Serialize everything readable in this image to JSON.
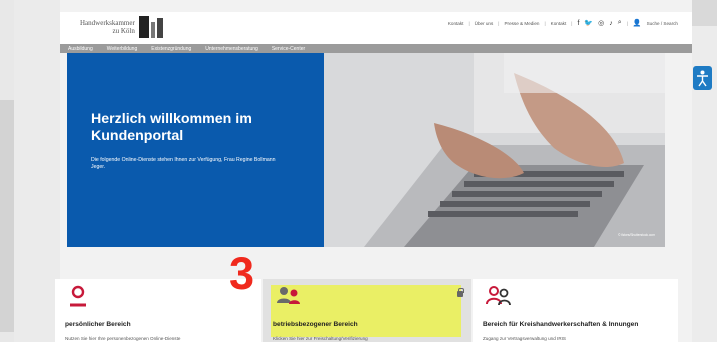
{
  "colors": {
    "hero_blue": "#0a5aad",
    "accent_red": "#c7193a",
    "highlight": "#eaf05a",
    "badge_red": "#f0291d",
    "nav_grey": "#9b9b9b"
  },
  "logo": {
    "line1": "Handwerkskammer",
    "line2": "zu Köln"
  },
  "topnav": {
    "items": [
      "Kontakt",
      "Über uns",
      "Presse & Medien",
      "Kontakt"
    ],
    "search": "Suche / Search",
    "icons": [
      "facebook-icon",
      "twitter-icon",
      "instagram-icon",
      "tiktok-icon",
      "search-icon",
      "user-icon"
    ]
  },
  "mainnav": {
    "items": [
      "Ausbildung",
      "Weiterbildung",
      "Existenzgründung",
      "Unternehmensberatung",
      "Service-Center"
    ]
  },
  "hero": {
    "title": "Herzlich willkommen im Kundenportal",
    "desc": "Die folgende Online-Dienste stehen Ihnen zur Verfügung, Frau Regine Bollmann Jeger.",
    "credit": "© fizkes/Shutterstock.com"
  },
  "annotation": {
    "number": "3"
  },
  "cards": [
    {
      "title": "persönlicher Bereich",
      "desc": "Nutzen Sie hier Ihre personenbezogenen Online-Dienste"
    },
    {
      "title": "betriebsbezogener Bereich",
      "desc": "Klicken Sie hier zur Freischaltung/Verifizierung"
    },
    {
      "title": "Bereich für Kreishandwerkerschaften & Innungen",
      "desc": "Zugang zur Vertragsverwaltung und IRIS"
    }
  ]
}
